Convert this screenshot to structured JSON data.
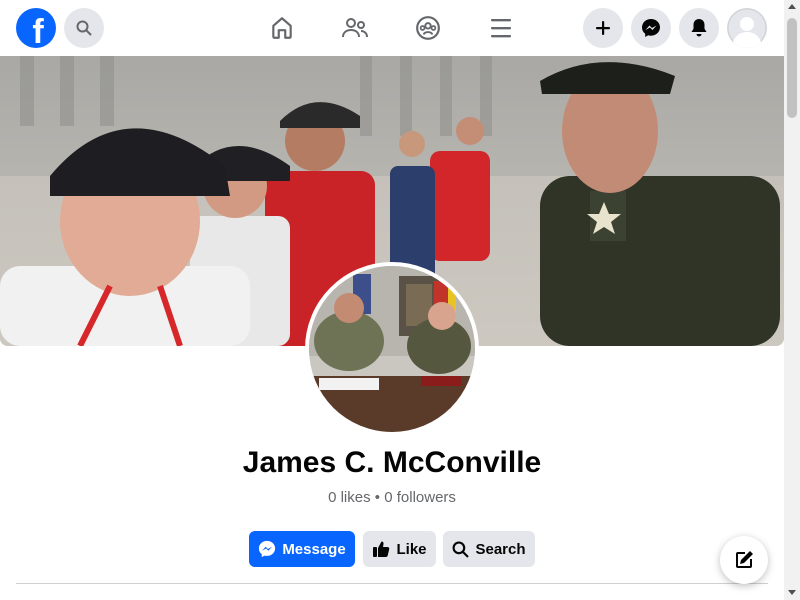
{
  "brand": {
    "logo_letter": "f",
    "color": "#0866ff"
  },
  "header": {
    "icons": [
      "search-icon",
      "home-icon",
      "friends-icon",
      "groups-icon",
      "menu-icon",
      "plus-icon",
      "messenger-icon",
      "bell-icon",
      "account-avatar-icon"
    ]
  },
  "profile": {
    "name": "James C. McConville",
    "likes": "0 likes",
    "separator": "•",
    "followers": "0 followers"
  },
  "actions": {
    "message_label": "Message",
    "like_label": "Like",
    "search_label": "Search"
  },
  "colors": {
    "primary": "#0866ff",
    "secondary_bg": "#e4e6eb",
    "text": "#050505",
    "muted": "#65676b"
  }
}
